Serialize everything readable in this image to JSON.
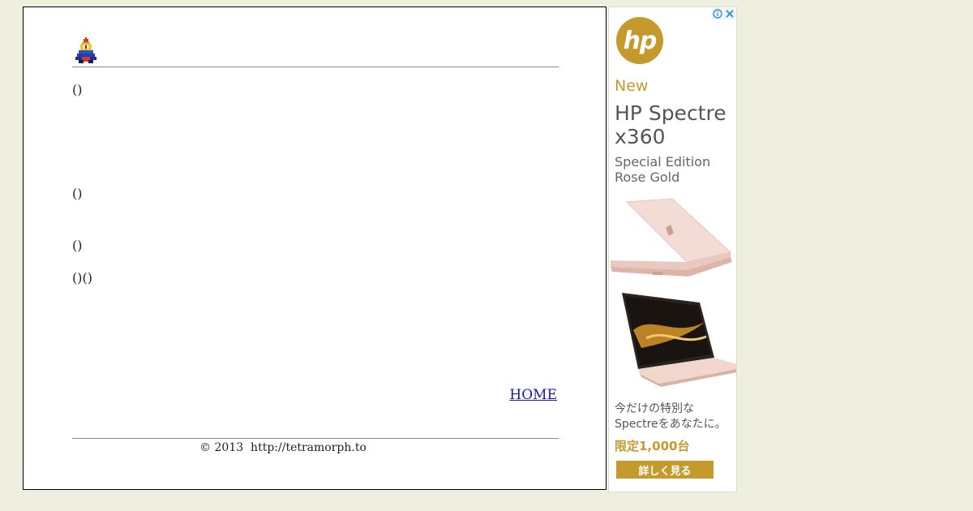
{
  "content": {
    "paragraphs": [
      "()",
      "()",
      "()",
      "()()"
    ],
    "home_link": "HOME",
    "footer": "© 2013  http://tetramorph.to"
  },
  "ad": {
    "logo_text": "hp",
    "new_label": "New",
    "title_line1": "HP Spectre",
    "title_line2": "x360",
    "subtitle_line1": "Special Edition",
    "subtitle_line2": "Rose Gold",
    "jp_line1": "今だけの特別な",
    "jp_line2": "Spectreをあなたに。",
    "limited": "限定1,000台",
    "cta": "詳しく見る",
    "accent_color": "#c49a2c"
  },
  "icons": {
    "logo": "pixel-figure-icon",
    "ad_info": "info-icon",
    "ad_close": "close-icon"
  }
}
